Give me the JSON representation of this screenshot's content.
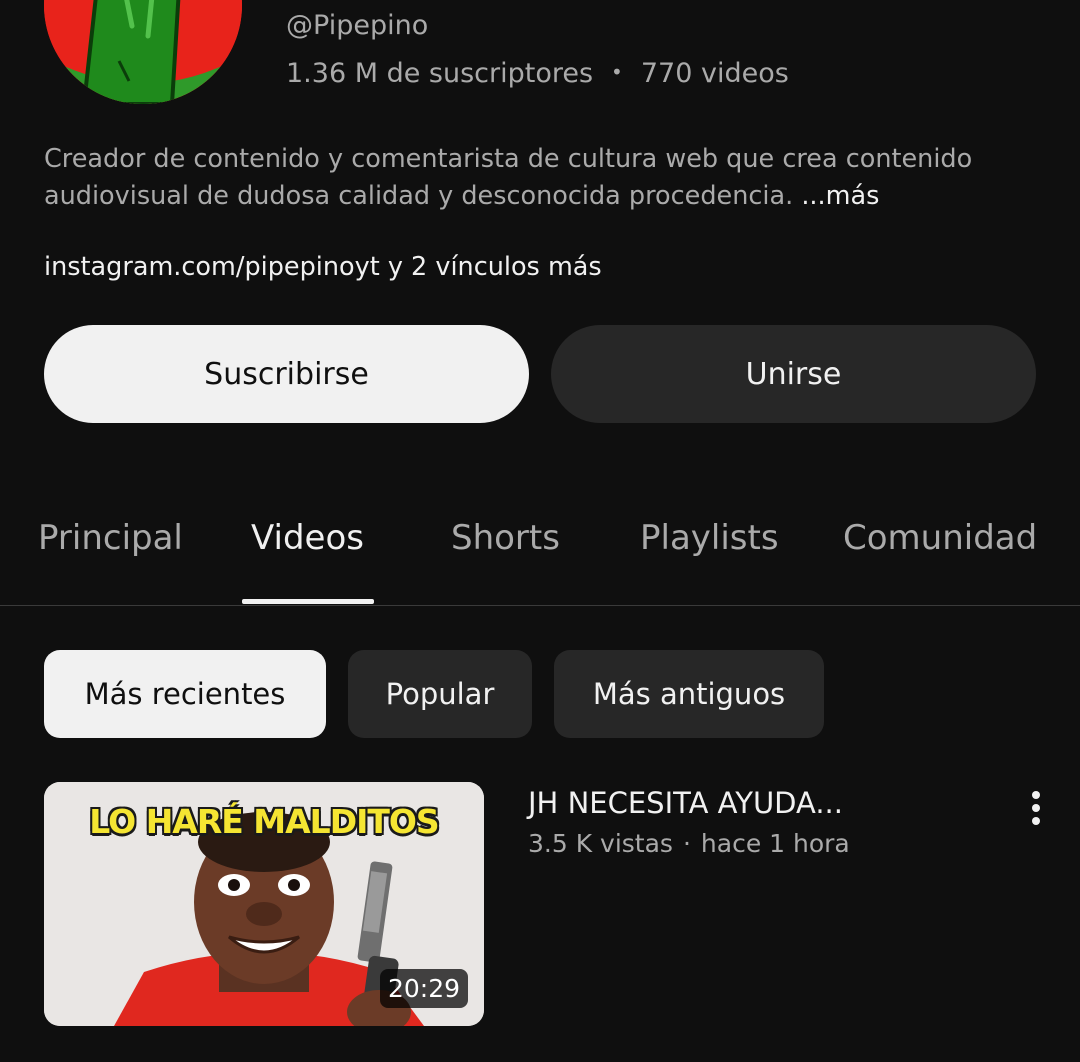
{
  "channel": {
    "handle": "@Pipepino",
    "subscribers": "1.36 M de suscriptores",
    "videos": "770 videos",
    "stats_separator": "•",
    "description": "Creador de contenido y comentarista de cultura web que crea contenido audiovisual de dudosa calidad y desconocida procedencia.",
    "more_label": "...más",
    "links_text": "instagram.com/pipepinoyt y 2 vínculos más"
  },
  "actions": {
    "subscribe_label": "Suscribirse",
    "join_label": "Unirse"
  },
  "tabs": [
    {
      "label": "Principal",
      "active": false
    },
    {
      "label": "Videos",
      "active": true
    },
    {
      "label": "Shorts",
      "active": false
    },
    {
      "label": "Playlists",
      "active": false
    },
    {
      "label": "Comunidad",
      "active": false
    }
  ],
  "filters": [
    {
      "label": "Más recientes",
      "selected": true
    },
    {
      "label": "Popular",
      "selected": false
    },
    {
      "label": "Más antiguos",
      "selected": false
    }
  ],
  "video": {
    "thumbnail_text": "LO HARÉ MALDITOS",
    "duration": "20:29",
    "title": "JH NECESITA AYUDA...",
    "views": "3.5 K vistas",
    "meta_separator": "·",
    "age": "hace 1 hora",
    "menu_icon": "more-vert-icon"
  },
  "colors": {
    "background": "#0f0f0f",
    "primary_text": "#f1f1f1",
    "secondary_text": "#aaaaaa",
    "chip_dark": "#272727",
    "avatar_red": "#e8231b",
    "avatar_green": "#2f9a2a"
  }
}
